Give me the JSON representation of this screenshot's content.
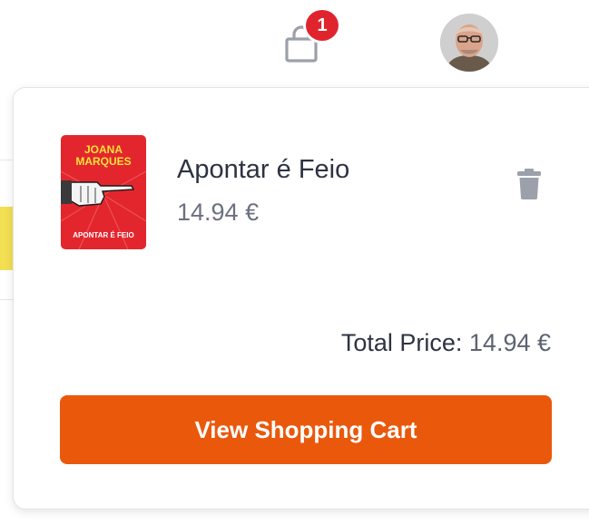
{
  "header": {
    "cart_icon": "shopping-bag-icon",
    "cart_badge_count": "1",
    "avatar_icon": "user-avatar"
  },
  "cart_dropdown": {
    "items": [
      {
        "cover": {
          "author_line1": "JOANA",
          "author_line2": "MARQUES",
          "cover_title": "APONTAR É FEIO",
          "cover_color": "#e3262d",
          "icon": "book-cover-image"
        },
        "title": "Apontar é Feio",
        "price": "14.94 €",
        "remove_icon": "trash-icon"
      }
    ],
    "total_label": "Total Price:",
    "total_value": "14.94 €",
    "view_cart_label": "View Shopping Cart"
  },
  "colors": {
    "accent": "#ea580c",
    "badge": "#e0242e",
    "text_primary": "#2d3342",
    "text_secondary": "#6b7180",
    "icon_gray": "#9ca0aa"
  }
}
